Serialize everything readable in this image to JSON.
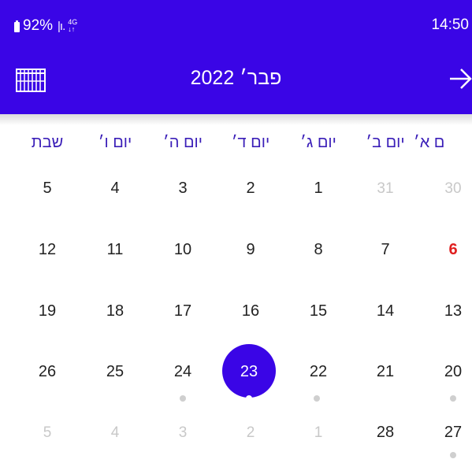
{
  "status_bar": {
    "battery": "92%",
    "signal": "|ı.",
    "network_top": "4G",
    "network_bottom": "↓↑",
    "time": "14:50"
  },
  "toolbar": {
    "title": "פבר׳ 2022",
    "left_icon": "calendar-grid-icon",
    "right_icon": "arrow-right-icon"
  },
  "weekdays": [
    "שבת",
    "יום ו׳",
    "יום ה׳",
    "יום ד׳",
    "יום ג׳",
    "יום ב׳",
    "ם א׳"
  ],
  "weeks": [
    [
      "5",
      "4",
      "3",
      "2",
      "1",
      "31",
      "30"
    ],
    [
      "12",
      "11",
      "10",
      "9",
      "8",
      "7",
      "6"
    ],
    [
      "19",
      "18",
      "17",
      "16",
      "15",
      "14",
      "13"
    ],
    [
      "26",
      "25",
      "24",
      "23",
      "22",
      "21",
      "20"
    ],
    [
      "5",
      "4",
      "3",
      "2",
      "1",
      "28",
      "27"
    ]
  ],
  "selected_date": "23",
  "colors": {
    "primary": "#3a05e6",
    "weekday_text": "#3a1eb8",
    "holiday_red": "#e02020",
    "muted": "#c8c8c8"
  }
}
